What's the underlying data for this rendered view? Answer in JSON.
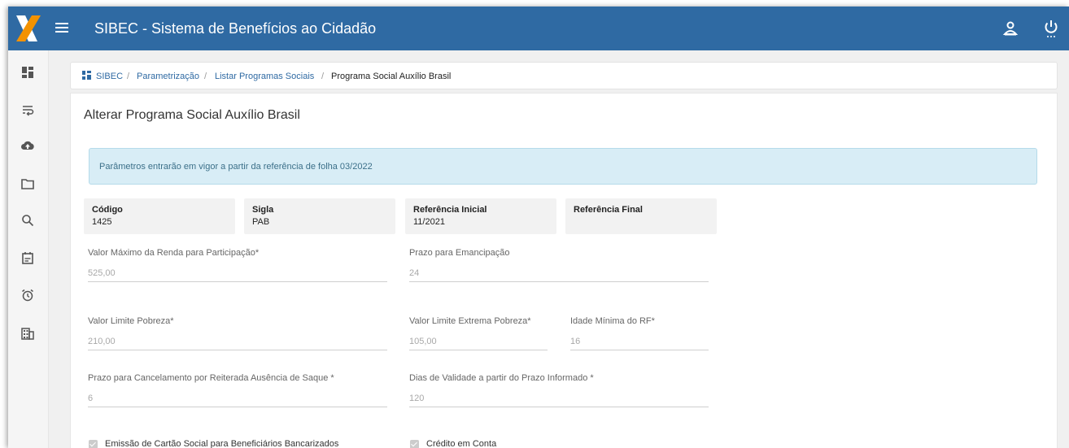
{
  "header": {
    "title": "SIBEC - Sistema de Benefícios ao Cidadão",
    "brand_color": "#2f6aa3",
    "logo_colors": [
      "#f39200",
      "#ffffff"
    ]
  },
  "sidebar": {
    "icons": [
      "dashboard-icon",
      "wrap-text-icon",
      "cloud-upload-icon",
      "folder-icon",
      "search-icon",
      "calendar-icon",
      "alarm-icon",
      "building-icon"
    ]
  },
  "breadcrumb": {
    "items": [
      "SIBEC",
      "Parametrização",
      "Listar Programas Sociais",
      "Programa Social Auxílio Brasil"
    ],
    "separator": "/"
  },
  "page": {
    "title": "Alterar Programa Social Auxílio Brasil",
    "alert": "Parâmetros entrarão em vigor a partir da referência de folha 03/2022"
  },
  "info": {
    "codigo": {
      "label": "Código",
      "value": "1425"
    },
    "sigla": {
      "label": "Sigla",
      "value": "PAB"
    },
    "ref_inicial": {
      "label": "Referência Inicial",
      "value": "11/2021"
    },
    "ref_final": {
      "label": "Referência Final",
      "value": ""
    }
  },
  "fields": {
    "valor_maximo": {
      "label": "Valor Máximo da Renda para Participação*",
      "value": "525,00"
    },
    "prazo_emancipacao": {
      "label": "Prazo para Emancipação",
      "value": "24"
    },
    "valor_limite_pobreza": {
      "label": "Valor Limite Pobreza*",
      "value": "210,00"
    },
    "valor_limite_extrema": {
      "label": "Valor Limite Extrema Pobreza*",
      "value": "105,00"
    },
    "idade_minima": {
      "label": "Idade Mínima do RF*",
      "value": "16"
    },
    "prazo_cancelamento": {
      "label": "Prazo para Cancelamento por Reiterada Ausência de Saque *",
      "value": "6"
    },
    "dias_validade": {
      "label": "Dias de Validade a partir do Prazo Informado *",
      "value": "120"
    }
  },
  "checkboxes": {
    "emissao_cartao": {
      "label": "Emissão de Cartão Social para Beneficiários Bancarizados",
      "checked": true
    },
    "credito_conta": {
      "label": "Crédito em Conta",
      "checked": true
    }
  }
}
